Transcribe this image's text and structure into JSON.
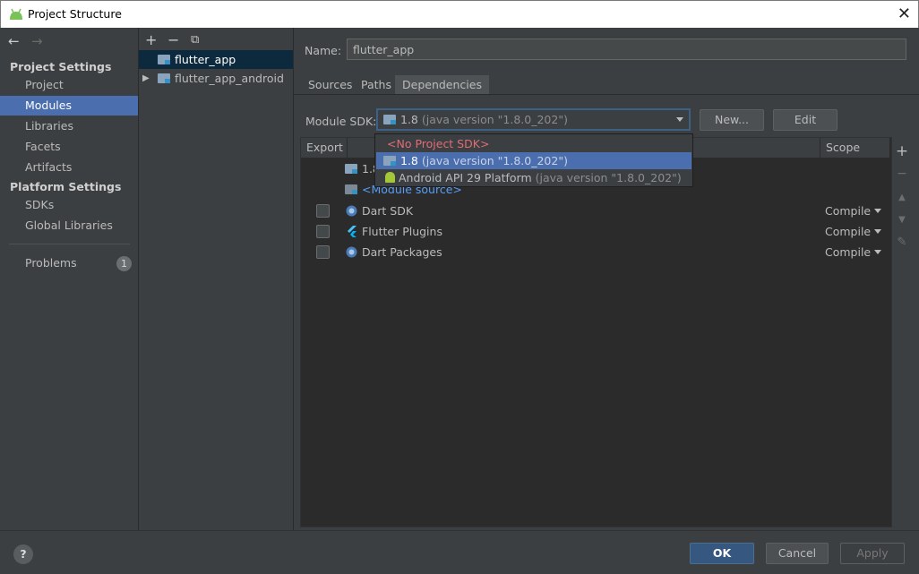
{
  "window": {
    "title": "Project Structure"
  },
  "nav": {
    "sections": [
      {
        "label": "Project Settings",
        "items": [
          {
            "label": "Project"
          },
          {
            "label": "Modules"
          },
          {
            "label": "Libraries"
          },
          {
            "label": "Facets"
          },
          {
            "label": "Artifacts"
          }
        ]
      },
      {
        "label": "Platform Settings",
        "items": [
          {
            "label": "SDKs"
          },
          {
            "label": "Global Libraries"
          }
        ]
      }
    ],
    "problems": {
      "label": "Problems",
      "count": "1"
    }
  },
  "modules": {
    "toolbar": {
      "add": "+",
      "remove": "−",
      "copy": "⧉"
    },
    "items": [
      {
        "label": "flutter_app",
        "selected": true
      },
      {
        "label": "flutter_app_android",
        "selected": false
      }
    ]
  },
  "main": {
    "name_label": "Name:",
    "name_value": "flutter_app",
    "tabs": [
      {
        "label": "Sources"
      },
      {
        "label": "Paths"
      },
      {
        "label": "Dependencies"
      }
    ],
    "active_tab": "Dependencies",
    "module_sdk_label": "Module SDK:",
    "module_sdk_value": "1.8",
    "module_sdk_detail": "(java version \"1.8.0_202\")",
    "new_button": "New...",
    "edit_button": "Edit",
    "columns": {
      "export": "Export",
      "scope": "Scope"
    },
    "rows": [
      {
        "label": "1.8",
        "icon": "folder-icon",
        "scope": ""
      },
      {
        "label": "<Module source>",
        "icon": "folder-icon",
        "scope": ""
      },
      {
        "label": "Dart SDK",
        "icon": "dart-icon",
        "scope": "Compile"
      },
      {
        "label": "Flutter Plugins",
        "icon": "flutter-icon",
        "scope": "Compile"
      },
      {
        "label": "Dart Packages",
        "icon": "dart-icon",
        "scope": "Compile"
      }
    ],
    "side_buttons": {
      "add": "+",
      "remove": "−",
      "up": "▲",
      "down": "▼",
      "edit": "✎"
    }
  },
  "dropdown": {
    "options": [
      {
        "label": "<No Project SDK>",
        "detail": "",
        "color": "#e06c75"
      },
      {
        "label": "1.8",
        "detail": "(java version \"1.8.0_202\")",
        "selected": true
      },
      {
        "label": "Android API 29 Platform",
        "detail": "(java version \"1.8.0_202\")"
      }
    ]
  },
  "footer": {
    "help": "?",
    "ok": "OK",
    "cancel": "Cancel",
    "apply": "Apply"
  },
  "colors": {
    "accent": "#4b6eaf",
    "link": "#589df6",
    "error": "#e06c75",
    "background": "#3c3f41"
  }
}
